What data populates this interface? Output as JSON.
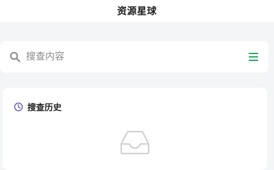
{
  "header": {
    "title": "资源星球"
  },
  "search": {
    "placeholder": "搜查内容",
    "value": "",
    "menu_icon": "menu-icon"
  },
  "history": {
    "heading": "搜查历史",
    "icon": "clock-icon",
    "empty_icon": "empty-inbox-icon",
    "items": []
  },
  "colors": {
    "accent": "#2fa86a",
    "history_icon": "#6b6bb8",
    "background": "#f4f5f7",
    "card": "#ffffff"
  }
}
